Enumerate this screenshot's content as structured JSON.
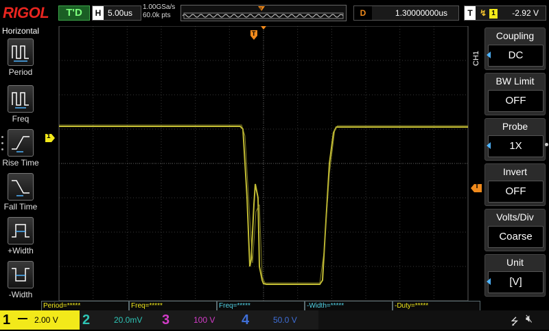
{
  "brand": "RIGOL",
  "top": {
    "trigger_state": "T'D",
    "horizontal_tag": "H",
    "horizontal_scale": "5.00us",
    "sample_rate": "1.00GSa/s",
    "memory_depth": "60.0k pts",
    "delay_tag": "D",
    "delay_value": "1.30000000us",
    "trigger_tag": "T",
    "trigger_channel": "1",
    "trigger_level": "-2.92 V"
  },
  "left_panel": {
    "title": "Horizontal",
    "items": [
      {
        "label": "Period",
        "icon": "period-icon"
      },
      {
        "label": "Freq",
        "icon": "freq-icon"
      },
      {
        "label": "Rise Time",
        "icon": "rise-time-icon"
      },
      {
        "label": "Fall Time",
        "icon": "fall-time-icon"
      },
      {
        "label": "+Width",
        "icon": "positive-width-icon"
      },
      {
        "label": "-Width",
        "icon": "negative-width-icon"
      }
    ]
  },
  "right_panel": {
    "channel_tab": "CH1",
    "items": [
      {
        "title": "Coupling",
        "value": "DC",
        "arrow": true
      },
      {
        "title": "BW Limit",
        "value": "OFF",
        "arrow": false
      },
      {
        "title": "Probe",
        "value": "1X",
        "arrow": true
      },
      {
        "title": "Invert",
        "value": "OFF",
        "arrow": false
      },
      {
        "title": "Volts/Div",
        "value": "Coarse",
        "arrow": false
      },
      {
        "title": "Unit",
        "value": "[V]",
        "arrow": true
      }
    ]
  },
  "markers": {
    "channel1": "1",
    "trigger_position": "T",
    "trigger_level": "T"
  },
  "measurements": [
    {
      "label": "Period=*****",
      "color": "#f2e91a"
    },
    {
      "label": "Freq=*****",
      "color": "#f2e91a"
    },
    {
      "label": "Freq=*****",
      "color": "#52d4e8"
    },
    {
      "label": "-Width=*****",
      "color": "#52d4e8"
    },
    {
      "label": "-Duty=*****",
      "color": "#f2e91a"
    }
  ],
  "channels": [
    {
      "num": "1",
      "value": "2.00 V",
      "color": "#f2e91a",
      "active": true
    },
    {
      "num": "2",
      "value": "20.0mV",
      "color": "#2ec4b6",
      "active": false
    },
    {
      "num": "3",
      "value": "100 V",
      "color": "#d23cc8",
      "active": false
    },
    {
      "num": "4",
      "value": "50.0 V",
      "color": "#3f6fd8",
      "active": false
    }
  ],
  "colors": {
    "ch1": "#f2e91a",
    "trigger": "#f08a1c",
    "grid": "#5a5a5a"
  }
}
